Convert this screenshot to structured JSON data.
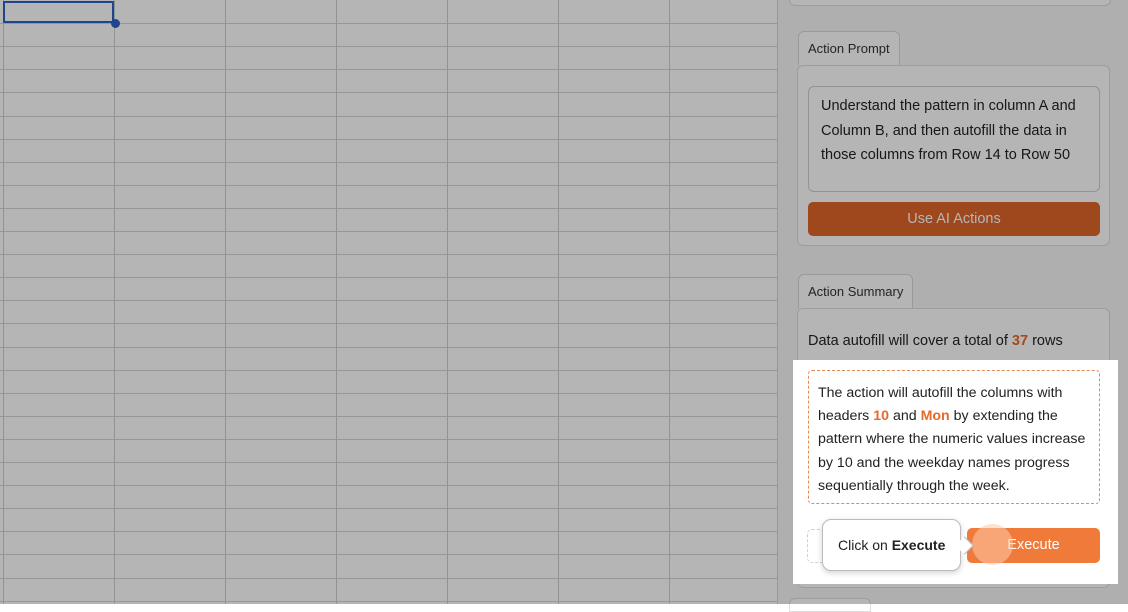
{
  "sheet": {
    "column_count": 7,
    "row_count": 27
  },
  "panel": {
    "action_prompt_tab": "Action Prompt",
    "prompt_text": "Understand the pattern in column A and Column B, and then autofill the data in those columns from Row 14 to Row 50",
    "use_ai_button": "Use AI Actions",
    "action_summary_tab": "Action Summary",
    "summary": {
      "prefix": "Data autofill will cover a total of ",
      "count": "37",
      "suffix": " rows"
    },
    "description": {
      "part1": "The action will autofill the columns with headers ",
      "header1": "10",
      "part2": " and ",
      "header2": "Mon",
      "part3": " by extending the pattern where the numeric values increase by 10 and the weekday names progress sequentially through the week."
    },
    "execute_button": "Execute"
  },
  "tooltip": {
    "prefix": "Click on ",
    "target": "Execute"
  },
  "colors": {
    "accent": "#f07a3a",
    "accent_dark": "#e0652a",
    "selection": "#2a63c9"
  }
}
